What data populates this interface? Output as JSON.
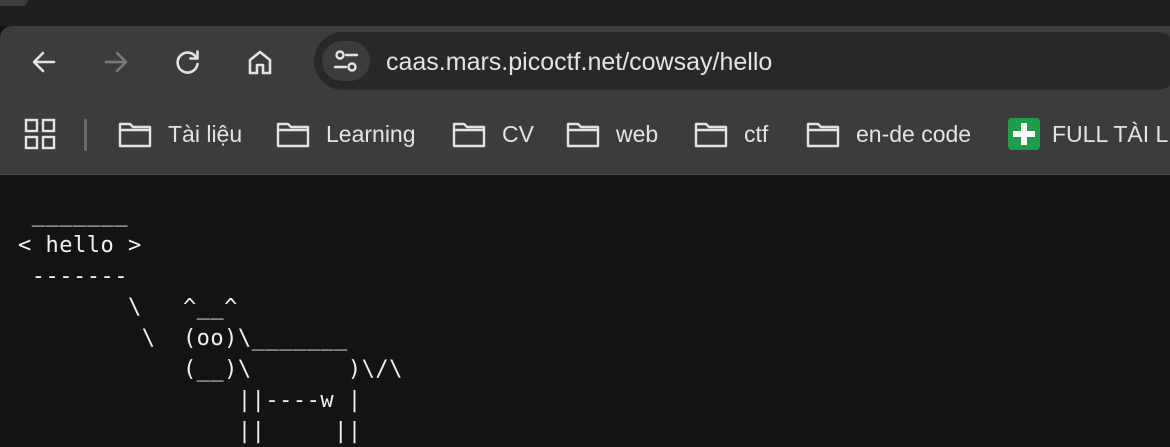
{
  "toolbar": {
    "back_icon": "arrow-left-icon",
    "forward_icon": "arrow-right-icon",
    "reload_icon": "reload-icon",
    "home_icon": "home-icon",
    "site_info_icon": "tune-icon",
    "url": "caas.mars.picoctf.net/cowsay/hello"
  },
  "bookmarks": {
    "apps_icon": "apps-grid-icon",
    "items": [
      {
        "label": "Tài liệu",
        "icon": "folder-icon"
      },
      {
        "label": "Learning",
        "icon": "folder-icon"
      },
      {
        "label": "CV",
        "icon": "folder-icon"
      },
      {
        "label": "web",
        "icon": "folder-icon"
      },
      {
        "label": "ctf",
        "icon": "folder-icon"
      },
      {
        "label": "en-de code",
        "icon": "folder-icon"
      },
      {
        "label": "FULL TÀI LI",
        "icon": "green-plus-favicon"
      }
    ]
  },
  "page": {
    "cowsay_output": " _______\n< hello >\n -------\n        \\   ^__^\n         \\  (oo)\\_______\n            (__)\\       )\\/\\\n                ||----w |\n                ||     ||"
  },
  "colors": {
    "toolbar_bg": "#3c3c3c",
    "omnibox_bg": "#282828",
    "page_bg": "#131313",
    "text": "#e3e3e3",
    "bookmark_favicon": "#1e9e4a"
  }
}
